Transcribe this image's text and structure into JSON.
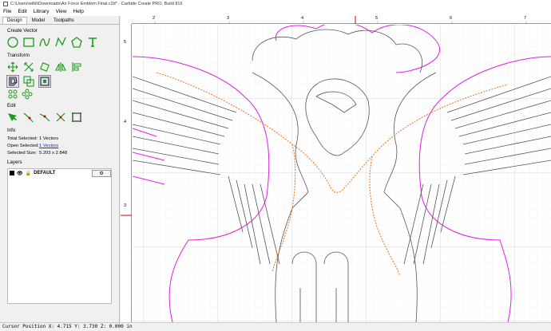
{
  "titlebar": {
    "title": "C:\\Users\\wilbl\\Downloads\\Air Force Emblem Final.c2d* - Carbide Create PRO, Build 816"
  },
  "menu": [
    "File",
    "Edit",
    "Library",
    "View",
    "Help"
  ],
  "tabs": [
    "Design",
    "Model",
    "Toolpaths"
  ],
  "sections": {
    "create_vector": "Create Vector",
    "transform": "Transform",
    "edit": "Edit",
    "info": "Info",
    "layers": "Layers"
  },
  "info": {
    "total_selected_label": "Total Selected:",
    "total_selected_value": "1 Vectors",
    "open_selected_label": "Open Selected:",
    "open_selected_value": "1 Vectors",
    "selected_size_label": "Selected Size:",
    "selected_size_value": "5.203 x 2.848"
  },
  "layers": [
    {
      "name": "DEFAULT",
      "color": "#000000"
    }
  ],
  "ruler": {
    "top_ticks": [
      "2",
      "3",
      "4",
      "5",
      "6",
      "7"
    ],
    "left_ticks": [
      "5",
      "4",
      "3"
    ]
  },
  "status": {
    "text": "Cursor Position X: 4.715 Y: 3.730 Z: 0.000 in"
  },
  "colors": {
    "vector": "#555555",
    "selected_path": "#e8701a",
    "offset_path": "#e020e0",
    "ruler_marker": "#d00000"
  }
}
